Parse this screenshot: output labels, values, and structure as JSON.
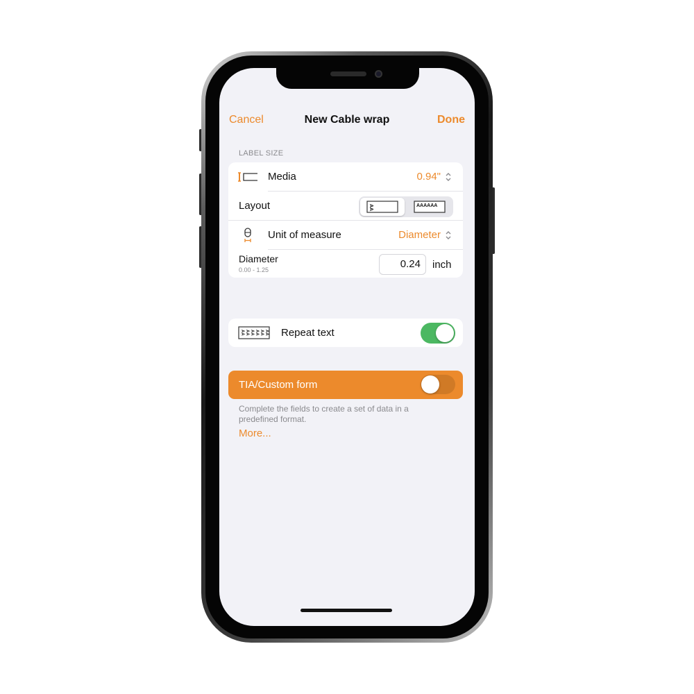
{
  "navbar": {
    "cancel_label": "Cancel",
    "title": "New Cable wrap",
    "done_label": "Done"
  },
  "label_size": {
    "header": "LABEL SIZE",
    "media": {
      "label": "Media",
      "value": "0.94\"",
      "icon": "media-width-icon"
    },
    "layout": {
      "label": "Layout",
      "options": [
        {
          "name": "vertical-layout",
          "preview_text": "AA",
          "selected": true
        },
        {
          "name": "horizontal-layout",
          "preview_text": "AAAAAA",
          "selected": false
        }
      ]
    },
    "unit_of_measure": {
      "label": "Unit of measure",
      "value": "Diameter",
      "icon": "cable-diameter-icon"
    },
    "diameter": {
      "label": "Diameter",
      "range": "0.00 - 1.25",
      "value": "0.24",
      "unit": "inch"
    }
  },
  "repeat_text": {
    "label": "Repeat text",
    "enabled": true,
    "icon": "repeat-text-icon"
  },
  "tia_custom": {
    "label": "TIA/Custom form",
    "enabled": false,
    "description": "Complete the fields to create a set of data in a predefined format.",
    "more_link": "More..."
  },
  "colors": {
    "accent": "#ec8a2c",
    "toggle_on": "#4cb862",
    "background": "#f2f2f7"
  }
}
